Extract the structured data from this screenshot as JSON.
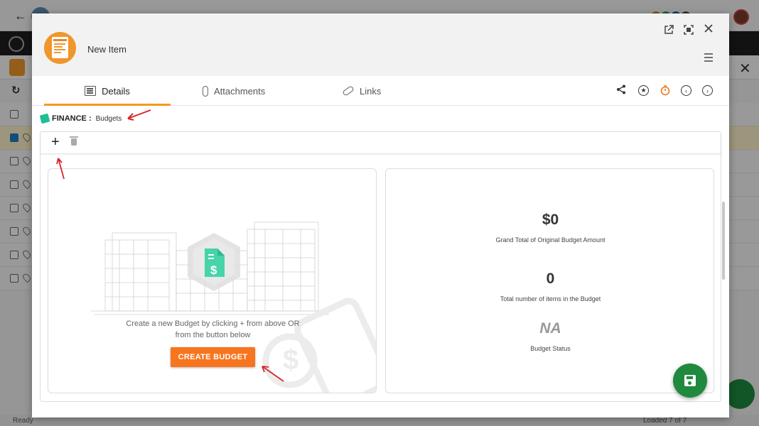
{
  "modal": {
    "title": "New Item"
  },
  "tabs": [
    {
      "label": "Details",
      "icon": "document-icon",
      "active": true
    },
    {
      "label": "Attachments",
      "icon": "paperclip-icon",
      "active": false
    },
    {
      "label": "Links",
      "icon": "link-icon",
      "active": false
    }
  ],
  "header_actions": [
    "external-link-icon",
    "maximize-icon",
    "close-icon",
    "hamburger-menu-icon"
  ],
  "tab_actions": [
    "share-icon",
    "star-icon",
    "timer-icon",
    "chevron-left-icon",
    "chevron-right-icon",
    "hamburger-menu-icon"
  ],
  "breadcrumb": {
    "section": "FINANCE :",
    "subsection": "Budgets"
  },
  "empty_state": {
    "line1": "Create a new Budget by clicking + from above OR",
    "line2": "from the button below",
    "button_label": "CREATE BUDGET"
  },
  "summary": {
    "grand_total_value": "$0",
    "grand_total_label": "Grand Total of Original Budget Amount",
    "item_count_value": "0",
    "item_count_label": "Total number of items in the Budget",
    "status_value": "NA",
    "status_label": "Budget Status"
  },
  "status_bar": {
    "ready": "Ready",
    "loaded": "Loaded 7 of 7"
  },
  "colors": {
    "accent_orange": "#f7751e",
    "tab_underline": "#f59a1f",
    "save_green": "#1f8a3e",
    "finance_teal": "#1fbf95",
    "annotation_red": "#d9252a"
  }
}
